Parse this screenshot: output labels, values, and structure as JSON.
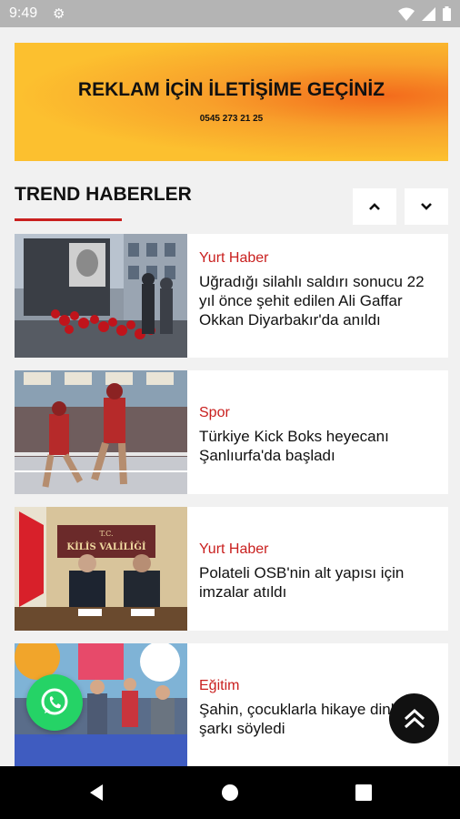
{
  "status_bar": {
    "time": "9:49",
    "icons": [
      "gear-icon",
      "wifi-icon",
      "signal-icon",
      "battery-icon"
    ]
  },
  "ad_banner": {
    "title": "REKLAM İÇİN İLETİŞİME GEÇİNİZ",
    "phone": "0545 273 21 25"
  },
  "section": {
    "title": "TREND HABERLER"
  },
  "articles": [
    {
      "category": "Yurt Haber",
      "headline": "Uğradığı silahlı saldırı sonucu 22 yıl önce şehit edilen Ali Gaffar Okkan Diyarbakır'da anıldı"
    },
    {
      "category": "Spor",
      "headline": "Türkiye Kick Boks heyecanı Şanlıurfa'da başladı"
    },
    {
      "category": "Yurt Haber",
      "headline": "Polateli OSB'nin alt yapısı için imzalar atıldı"
    },
    {
      "category": "Eğitim",
      "headline": "Şahin, çocuklarla hikaye dinleyip, şarkı söyledi"
    }
  ],
  "photo_text": {
    "sign_line1": "T.C.",
    "sign_line2": "KİLİS VALİLİĞİ"
  },
  "colors": {
    "accent": "#c9201f",
    "whatsapp": "#25d366"
  }
}
